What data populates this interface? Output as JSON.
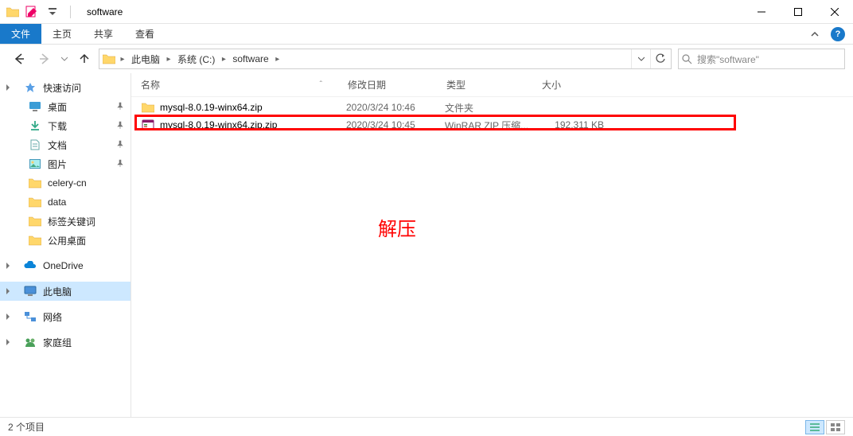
{
  "window": {
    "title": "software"
  },
  "ribbon": {
    "file": "文件",
    "tabs": [
      "主页",
      "共享",
      "查看"
    ]
  },
  "breadcrumbs": [
    "此电脑",
    "系统 (C:)",
    "software"
  ],
  "search": {
    "placeholder": "搜索\"software\""
  },
  "sidebar": {
    "quick_access": "快速访问",
    "desktop": "桌面",
    "downloads": "下载",
    "documents": "文档",
    "pictures": "图片",
    "celery": "celery-cn",
    "data": "data",
    "tags": "标签关键词",
    "public_desktop": "公用桌面",
    "onedrive": "OneDrive",
    "this_pc": "此电脑",
    "network": "网络",
    "homegroup": "家庭组"
  },
  "columns": {
    "name": "名称",
    "date": "修改日期",
    "type": "类型",
    "size": "大小"
  },
  "files": [
    {
      "name": "mysql-8.0.19-winx64.zip",
      "date": "2020/3/24 10:46",
      "type": "文件夹",
      "size": "",
      "kind": "folder"
    },
    {
      "name": "mysql-8.0.19-winx64.zip.zip",
      "date": "2020/3/24 10:45",
      "type": "WinRAR ZIP 压缩...",
      "size": "192,311 KB",
      "kind": "zip"
    }
  ],
  "annotation": "解压",
  "status": "2 个项目"
}
